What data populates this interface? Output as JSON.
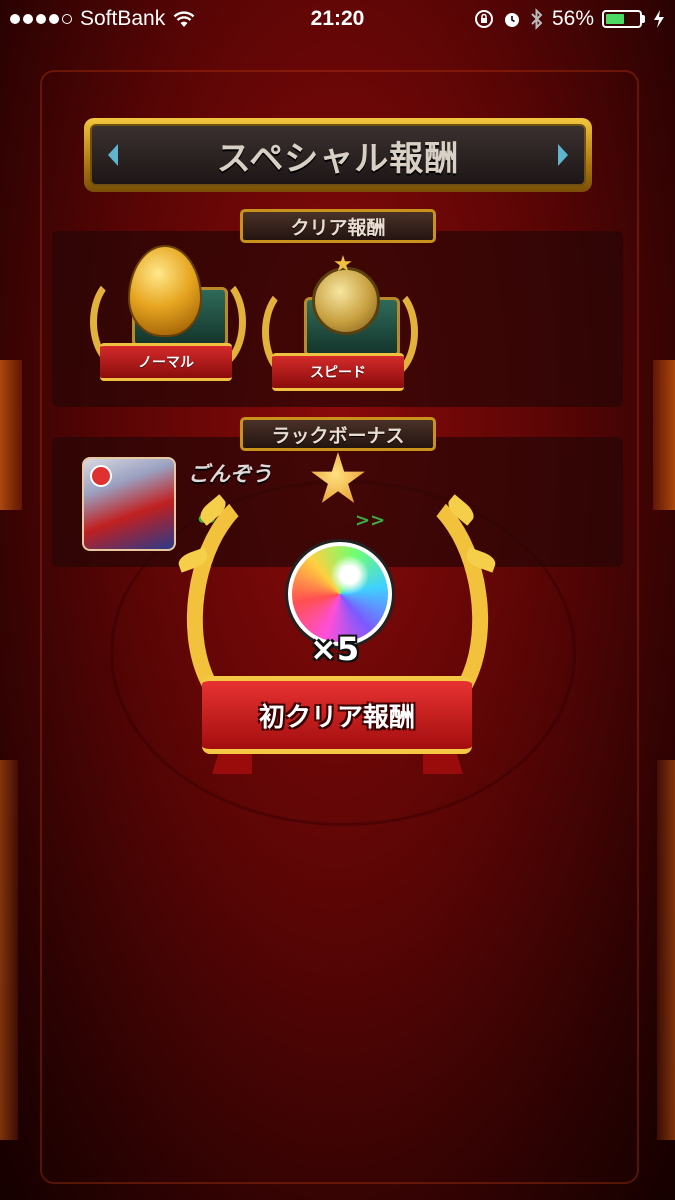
{
  "status_bar": {
    "carrier": "SoftBank",
    "time": "21:20",
    "battery_percent": "56%",
    "battery_level": 0.56,
    "signal_bars_filled": 4,
    "signal_bars_total": 5
  },
  "title": "スペシャル報酬",
  "clear_reward": {
    "header": "クリア報酬",
    "items": [
      {
        "label": "ノーマル",
        "icon": "golden-egg-icon"
      },
      {
        "label": "スピード",
        "icon": "gold-coin-icon"
      }
    ]
  },
  "luck_bonus": {
    "header": "ラックボーナス",
    "player_name": "ごんぞう",
    "icon": "clover-icon",
    "arrows": ">>"
  },
  "first_clear": {
    "label": "初クリア報酬",
    "item_icon": "rainbow-orb-icon",
    "count": "×5"
  },
  "colors": {
    "background": "#5a0505",
    "gold": "#f2c23c",
    "ribbon_red": "#d42a2a",
    "battery_green": "#4cd964"
  }
}
